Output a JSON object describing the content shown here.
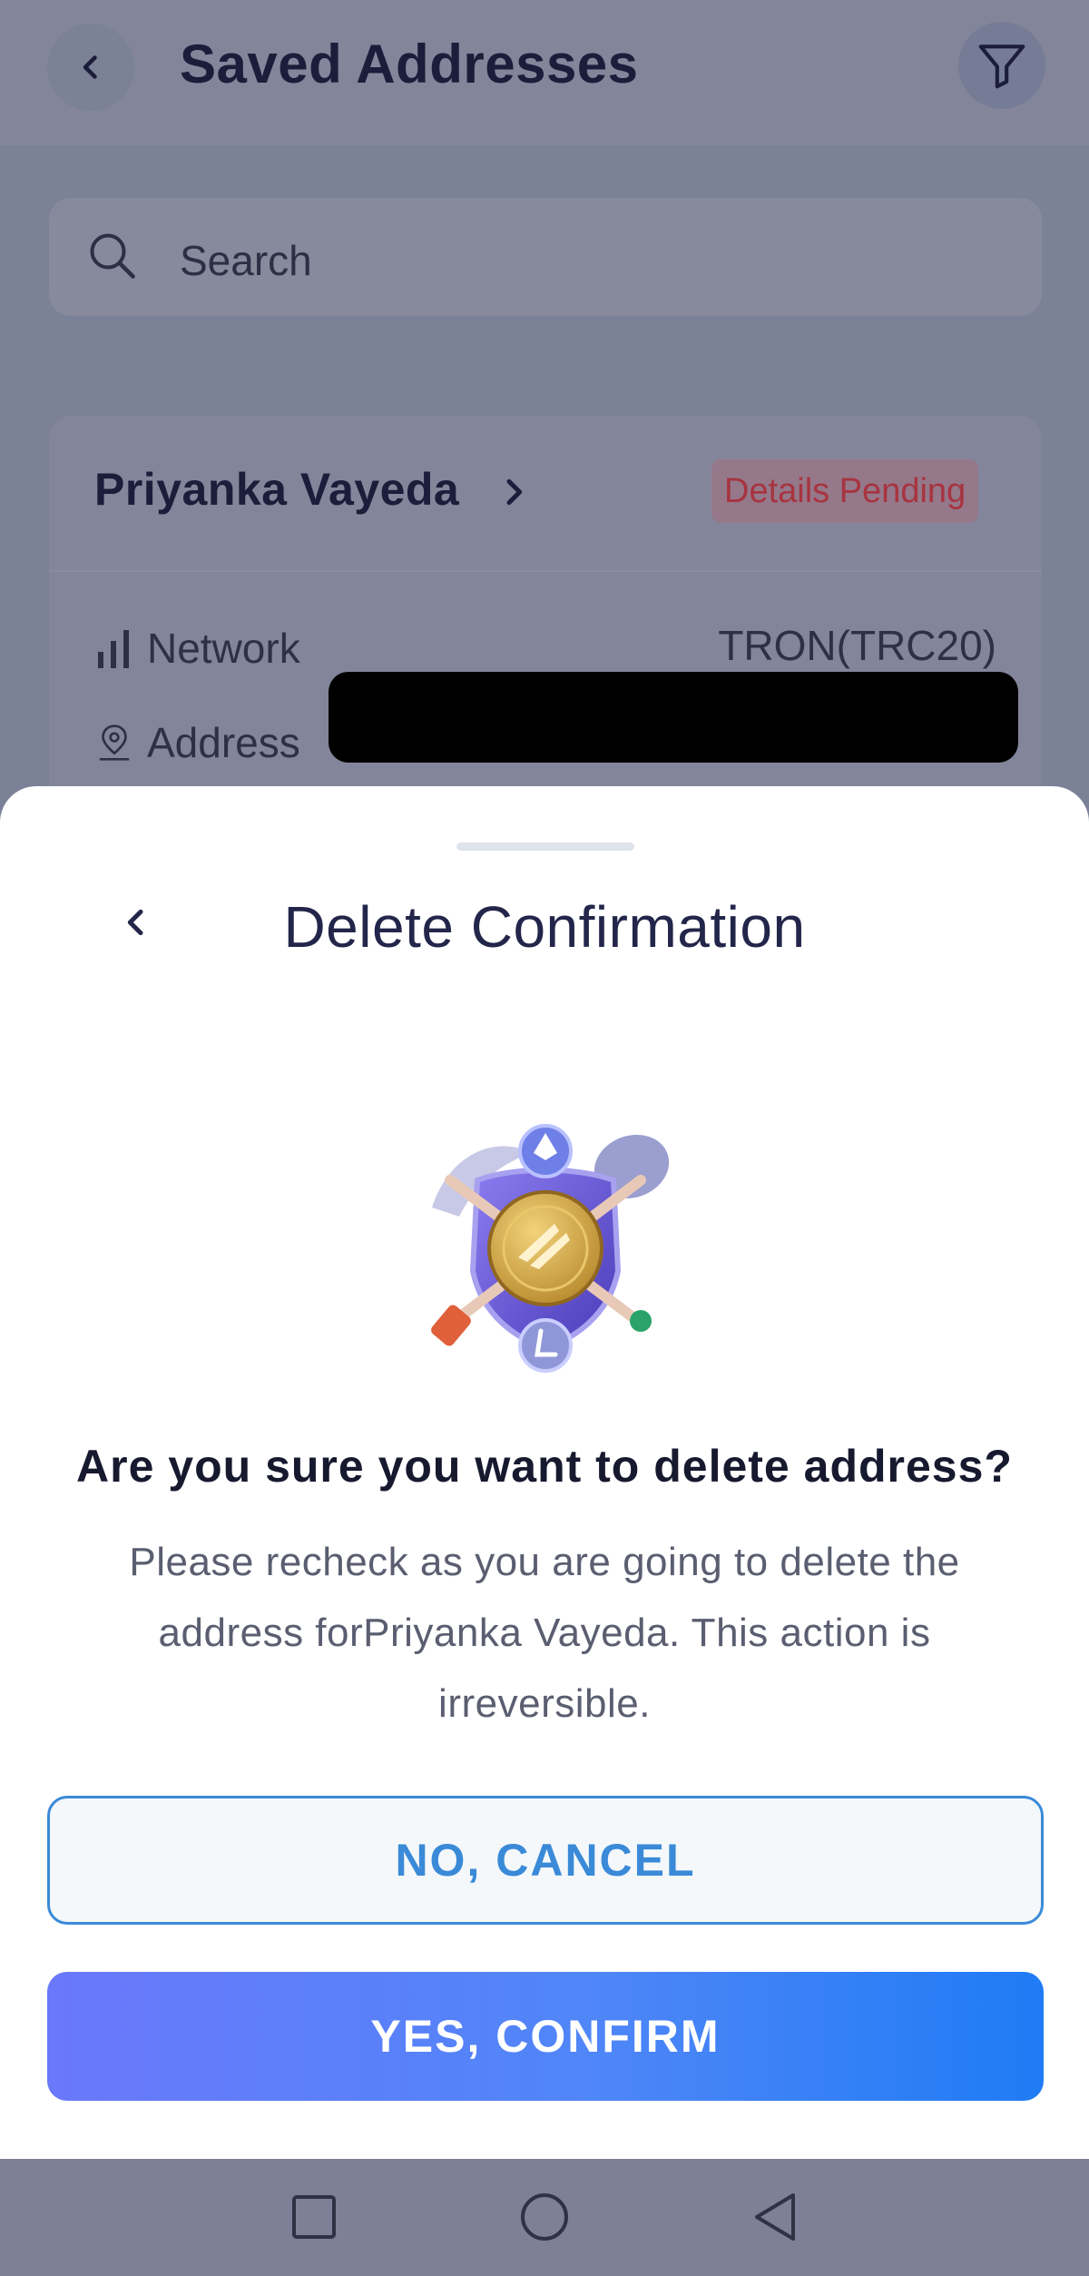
{
  "header": {
    "title": "Saved Addresses",
    "back_icon": "chevron-left-icon",
    "filter_icon": "filter-icon"
  },
  "search": {
    "placeholder": "Search"
  },
  "address_card": {
    "name": "Priyanka Vayeda",
    "status_badge": "Details Pending",
    "network_label": "Network",
    "network_value": "TRON(TRC20)",
    "address_label": "Address"
  },
  "sheet": {
    "title": "Delete Confirmation",
    "question": "Are you sure you want to delete address?",
    "description": "Please recheck as you are going to delete the address forPriyanka Vayeda. This action is irreversible.",
    "cancel_label": "NO, CANCEL",
    "confirm_label": "YES, CONFIRM"
  },
  "colors": {
    "accent": "#3a8ad8",
    "confirm_gradient_start": "#6a78fb",
    "confirm_gradient_end": "#1f7bf4",
    "badge_text": "#a7343f",
    "title_text": "#23264a"
  }
}
